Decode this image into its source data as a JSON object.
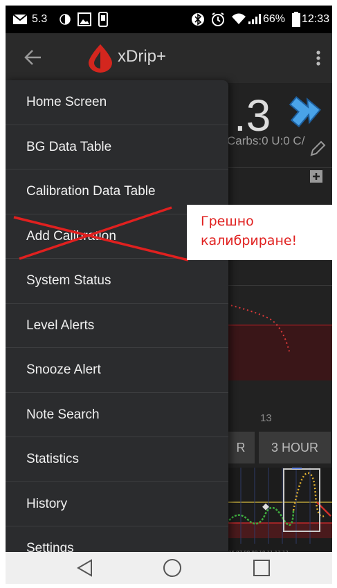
{
  "status_bar": {
    "notification_number": "5.3",
    "battery_percent": "66%",
    "time": "12:33",
    "icons": [
      "mail-icon",
      "half-moon-icon",
      "image-icon",
      "phone-frame-icon",
      "bluetooth-icon",
      "alarm-icon",
      "wifi-icon",
      "signal-icon",
      "battery-icon"
    ]
  },
  "app_bar": {
    "title": "xDrip+",
    "back_icon": "back-arrow-icon",
    "logo_icon": "blood-drop-icon",
    "overflow_icon": "more-vert-icon"
  },
  "background": {
    "bg_value": ".3",
    "carbs_text": "Carbs:0 U:0 C/",
    "axis_label": "13",
    "range_left_label": "R",
    "range_3hour_label": "3 HOUR"
  },
  "drawer": {
    "items": [
      {
        "label": "Home Screen"
      },
      {
        "label": "BG Data Table"
      },
      {
        "label": "Calibration Data Table"
      },
      {
        "label": "Add Calibration",
        "struck_out": true
      },
      {
        "label": "System Status"
      },
      {
        "label": "Level Alerts"
      },
      {
        "label": "Snooze Alert"
      },
      {
        "label": "Note Search"
      },
      {
        "label": "Statistics"
      },
      {
        "label": "History"
      },
      {
        "label": "Settings"
      }
    ]
  },
  "annotation": {
    "line1": "Грешно",
    "line2": "калибриране!",
    "color": "#e0201f"
  },
  "nav_bar": {
    "icons": [
      "nav-back-icon",
      "nav-home-icon",
      "nav-recent-icon"
    ]
  }
}
